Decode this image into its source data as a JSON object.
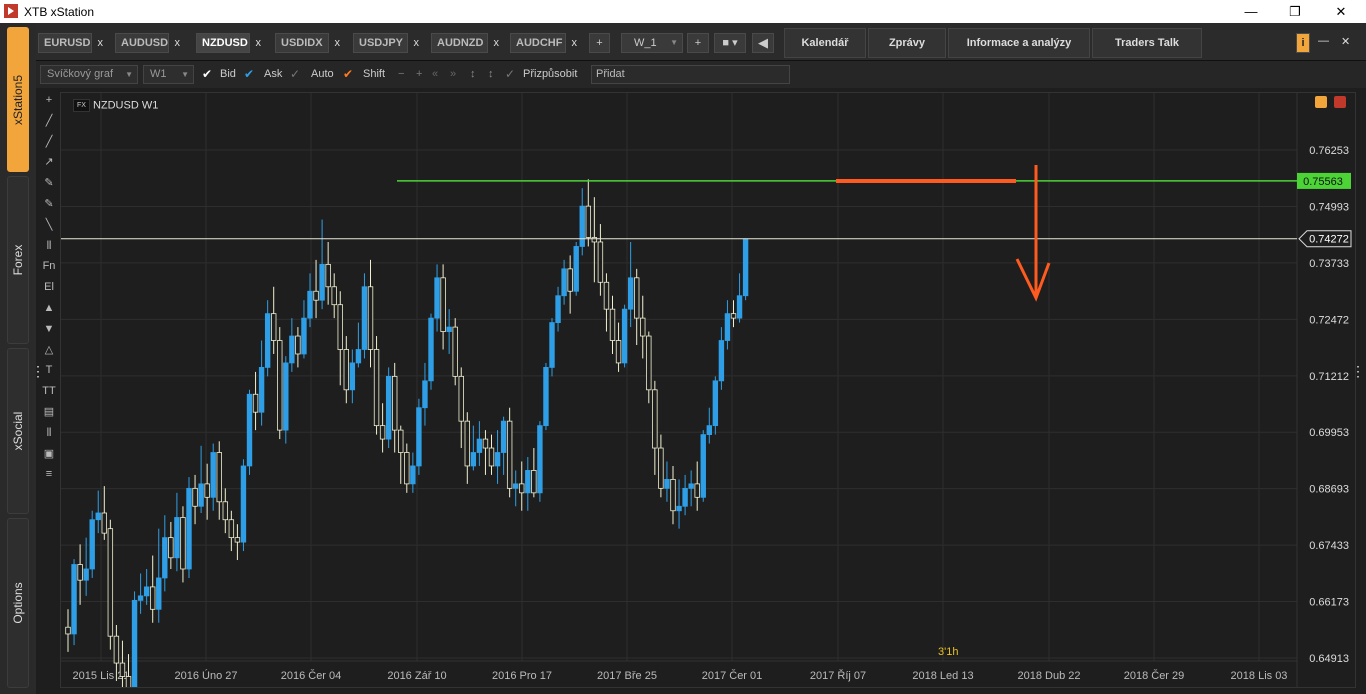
{
  "window": {
    "title": "XTB xStation",
    "minimize": "—",
    "maximize": "❐",
    "close": "✕"
  },
  "rail": {
    "tabs": [
      "xStation5",
      "Forex",
      "xSocial",
      "Options"
    ]
  },
  "topbar": {
    "symbols": [
      "EURUSD",
      "AUDUSD",
      "NZDUSD",
      "USDIDX",
      "USDJPY",
      "AUDNZD",
      "AUDCHF"
    ],
    "close_glyph": "x",
    "add_glyph": "+",
    "workspace": "W_1",
    "nav": [
      "Kalendář",
      "Zprávy",
      "Informace a analýzy",
      "Traders Talk"
    ],
    "info_glyph": "i",
    "minimize_glyph": "—",
    "close_window_glyph": "✕"
  },
  "toolbar": {
    "chart_type": "Svíčkový graf",
    "timeframe": "W1",
    "bid": "Bid",
    "ask": "Ask",
    "auto": "Auto",
    "shift": "Shift",
    "fit": "Přizpůsobit",
    "add_placeholder": "Přidat"
  },
  "drawing_tools": [
    "+",
    "╱",
    "╱",
    "↗",
    "✎",
    "✎",
    "╲",
    "⫴",
    "Fn",
    "El",
    "▲",
    "▼",
    "△",
    "T",
    "TT",
    "▤",
    "⫴",
    "▣",
    "≡"
  ],
  "chart_data": {
    "type": "candlestick",
    "title": "NZDUSD W1",
    "instrument_badge": "FX",
    "y_ticks": [
      "0.76253",
      "0.74993",
      "0.73733",
      "0.72472",
      "0.71212",
      "0.69953",
      "0.68693",
      "0.67433",
      "0.66173",
      "0.64913"
    ],
    "y_tick_values": [
      0.76253,
      0.74993,
      0.73733,
      0.72472,
      0.71212,
      0.69953,
      0.68693,
      0.67433,
      0.66173,
      0.64913
    ],
    "x_ticks": [
      "2015 Lis 21",
      "2016 Úno 27",
      "2016 Čer 04",
      "2016 Zář 10",
      "2016 Pro 17",
      "2017 Bře 25",
      "2017 Čer 01",
      "2017 Říj 07",
      "2018 Led 13",
      "2018 Dub 22",
      "2018 Čer 29",
      "2018 Lis 03"
    ],
    "resistance_level": 0.75563,
    "resistance_label": "0.75563",
    "current_price": 0.74272,
    "current_price_label": "0.74272",
    "countdown": "3'1h",
    "colors": {
      "bull": "#2e9fe6",
      "bear": "#1e1e1e",
      "bear_outline": "#f0f0d0",
      "wick": "#f0f0d0",
      "resistance": "#4cd437",
      "current_line": "#e8e8d8",
      "annotation": "#ff5a1f",
      "countdown": "#e8c020"
    },
    "candles": [
      [
        0.656,
        0.6545,
        0.66,
        0.6505
      ],
      [
        0.6545,
        0.67,
        0.6712,
        0.652
      ],
      [
        0.67,
        0.6665,
        0.6745,
        0.661
      ],
      [
        0.6665,
        0.669,
        0.676,
        0.663
      ],
      [
        0.669,
        0.68,
        0.682,
        0.667
      ],
      [
        0.68,
        0.6815,
        0.6865,
        0.677
      ],
      [
        0.6815,
        0.677,
        0.6875,
        0.6755
      ],
      [
        0.678,
        0.654,
        0.68,
        0.651
      ],
      [
        0.654,
        0.648,
        0.6565,
        0.644
      ],
      [
        0.648,
        0.645,
        0.653,
        0.642
      ],
      [
        0.645,
        0.642,
        0.65,
        0.638
      ],
      [
        0.642,
        0.662,
        0.664,
        0.64
      ],
      [
        0.662,
        0.663,
        0.668,
        0.659
      ],
      [
        0.663,
        0.665,
        0.669,
        0.661
      ],
      [
        0.665,
        0.66,
        0.672,
        0.657
      ],
      [
        0.66,
        0.667,
        0.678,
        0.657
      ],
      [
        0.667,
        0.676,
        0.681,
        0.664
      ],
      [
        0.676,
        0.6715,
        0.6795,
        0.669
      ],
      [
        0.6715,
        0.6805,
        0.686,
        0.6685
      ],
      [
        0.6805,
        0.669,
        0.683,
        0.666
      ],
      [
        0.669,
        0.687,
        0.6895,
        0.667
      ],
      [
        0.687,
        0.683,
        0.69,
        0.679
      ],
      [
        0.683,
        0.688,
        0.6965,
        0.6815
      ],
      [
        0.688,
        0.685,
        0.6925,
        0.68
      ],
      [
        0.685,
        0.695,
        0.697,
        0.682
      ],
      [
        0.695,
        0.684,
        0.6975,
        0.68
      ],
      [
        0.684,
        0.68,
        0.687,
        0.677
      ],
      [
        0.68,
        0.676,
        0.682,
        0.673
      ],
      [
        0.676,
        0.675,
        0.679,
        0.671
      ],
      [
        0.675,
        0.692,
        0.6935,
        0.673
      ],
      [
        0.692,
        0.708,
        0.709,
        0.69
      ],
      [
        0.708,
        0.704,
        0.713,
        0.7
      ],
      [
        0.704,
        0.714,
        0.72,
        0.701
      ],
      [
        0.714,
        0.726,
        0.729,
        0.712
      ],
      [
        0.726,
        0.72,
        0.732,
        0.717
      ],
      [
        0.72,
        0.7,
        0.723,
        0.698
      ],
      [
        0.7,
        0.715,
        0.7165,
        0.697
      ],
      [
        0.715,
        0.721,
        0.725,
        0.713
      ],
      [
        0.721,
        0.717,
        0.723,
        0.714
      ],
      [
        0.717,
        0.725,
        0.729,
        0.716
      ],
      [
        0.725,
        0.731,
        0.735,
        0.723
      ],
      [
        0.731,
        0.729,
        0.738,
        0.725
      ],
      [
        0.729,
        0.737,
        0.747,
        0.727
      ],
      [
        0.737,
        0.732,
        0.742,
        0.728
      ],
      [
        0.732,
        0.728,
        0.735,
        0.725
      ],
      [
        0.728,
        0.718,
        0.731,
        0.71
      ],
      [
        0.718,
        0.709,
        0.721,
        0.706
      ],
      [
        0.709,
        0.715,
        0.718,
        0.706
      ],
      [
        0.715,
        0.718,
        0.724,
        0.714
      ],
      [
        0.718,
        0.732,
        0.735,
        0.716
      ],
      [
        0.732,
        0.718,
        0.738,
        0.714
      ],
      [
        0.718,
        0.701,
        0.721,
        0.699
      ],
      [
        0.701,
        0.698,
        0.706,
        0.695
      ],
      [
        0.698,
        0.712,
        0.714,
        0.696
      ],
      [
        0.712,
        0.7,
        0.715,
        0.695
      ],
      [
        0.7,
        0.695,
        0.701,
        0.688
      ],
      [
        0.695,
        0.688,
        0.697,
        0.686
      ],
      [
        0.688,
        0.692,
        0.695,
        0.686
      ],
      [
        0.692,
        0.705,
        0.707,
        0.69
      ],
      [
        0.705,
        0.711,
        0.715,
        0.701
      ],
      [
        0.711,
        0.725,
        0.726,
        0.709
      ],
      [
        0.725,
        0.734,
        0.737,
        0.722
      ],
      [
        0.734,
        0.722,
        0.737,
        0.718
      ],
      [
        0.722,
        0.723,
        0.727,
        0.717
      ],
      [
        0.723,
        0.712,
        0.725,
        0.71
      ],
      [
        0.712,
        0.702,
        0.714,
        0.696
      ],
      [
        0.702,
        0.692,
        0.704,
        0.688
      ],
      [
        0.692,
        0.695,
        0.701,
        0.691
      ],
      [
        0.695,
        0.698,
        0.702,
        0.692
      ],
      [
        0.698,
        0.696,
        0.7,
        0.69
      ],
      [
        0.696,
        0.692,
        0.699,
        0.69
      ],
      [
        0.692,
        0.695,
        0.7,
        0.688
      ],
      [
        0.695,
        0.702,
        0.703,
        0.69
      ],
      [
        0.702,
        0.687,
        0.705,
        0.685
      ],
      [
        0.687,
        0.688,
        0.691,
        0.683
      ],
      [
        0.688,
        0.686,
        0.693,
        0.682
      ],
      [
        0.686,
        0.691,
        0.694,
        0.682
      ],
      [
        0.691,
        0.686,
        0.696,
        0.685
      ],
      [
        0.686,
        0.701,
        0.702,
        0.684
      ],
      [
        0.701,
        0.714,
        0.715,
        0.7
      ],
      [
        0.714,
        0.724,
        0.725,
        0.712
      ],
      [
        0.724,
        0.73,
        0.732,
        0.722
      ],
      [
        0.73,
        0.736,
        0.738,
        0.728
      ],
      [
        0.736,
        0.731,
        0.739,
        0.726
      ],
      [
        0.731,
        0.741,
        0.742,
        0.73
      ],
      [
        0.741,
        0.75,
        0.754,
        0.739
      ],
      [
        0.75,
        0.743,
        0.756,
        0.741
      ],
      [
        0.743,
        0.742,
        0.752,
        0.733
      ],
      [
        0.742,
        0.733,
        0.746,
        0.73
      ],
      [
        0.733,
        0.727,
        0.735,
        0.722
      ],
      [
        0.727,
        0.72,
        0.73,
        0.717
      ],
      [
        0.72,
        0.715,
        0.724,
        0.713
      ],
      [
        0.715,
        0.727,
        0.728,
        0.714
      ],
      [
        0.727,
        0.734,
        0.742,
        0.723
      ],
      [
        0.734,
        0.725,
        0.736,
        0.719
      ],
      [
        0.725,
        0.721,
        0.73,
        0.716
      ],
      [
        0.721,
        0.709,
        0.722,
        0.706
      ],
      [
        0.709,
        0.696,
        0.711,
        0.69
      ],
      [
        0.696,
        0.687,
        0.699,
        0.685
      ],
      [
        0.687,
        0.689,
        0.693,
        0.684
      ],
      [
        0.689,
        0.682,
        0.692,
        0.679
      ],
      [
        0.682,
        0.683,
        0.689,
        0.678
      ],
      [
        0.683,
        0.687,
        0.69,
        0.681
      ],
      [
        0.687,
        0.688,
        0.691,
        0.683
      ],
      [
        0.688,
        0.685,
        0.693,
        0.682
      ],
      [
        0.685,
        0.699,
        0.7,
        0.684
      ],
      [
        0.699,
        0.701,
        0.705,
        0.697
      ],
      [
        0.701,
        0.711,
        0.712,
        0.699
      ],
      [
        0.711,
        0.72,
        0.723,
        0.709
      ],
      [
        0.72,
        0.726,
        0.729,
        0.718
      ],
      [
        0.726,
        0.725,
        0.729,
        0.723
      ],
      [
        0.725,
        0.73,
        0.735,
        0.724
      ],
      [
        0.73,
        0.7427,
        0.7428,
        0.729
      ]
    ]
  }
}
